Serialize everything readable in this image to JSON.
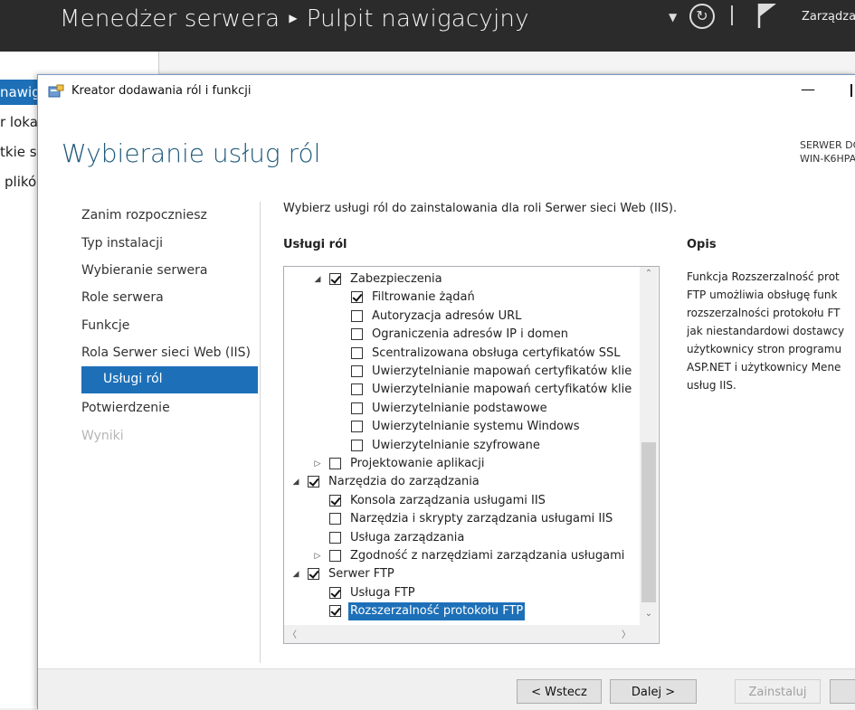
{
  "server_manager": {
    "title": "Menedżer serwera",
    "breadcrumb": "Pulpit nawigacyjny",
    "manage_menu": "Zarządza",
    "sidebar": [
      {
        "label": "nawig",
        "active": true
      },
      {
        "label": "r loka",
        "active": false
      },
      {
        "label": "tkie s",
        "active": false
      },
      {
        "label": "plikó",
        "active": false
      }
    ]
  },
  "wizard": {
    "window_title": "Kreator dodawania ról i funkcji",
    "page_title": "Wybieranie usług ról",
    "server_label_line1": "SERWER DO",
    "server_label_line2": "WIN-K6HPA",
    "steps": [
      {
        "label": "Zanim rozpoczniesz",
        "state": "normal"
      },
      {
        "label": "Typ instalacji",
        "state": "normal"
      },
      {
        "label": "Wybieranie serwera",
        "state": "normal"
      },
      {
        "label": "Role serwera",
        "state": "normal"
      },
      {
        "label": "Funkcje",
        "state": "normal"
      },
      {
        "label": "Rola Serwer sieci Web (IIS)",
        "state": "normal"
      },
      {
        "label": "Usługi ról",
        "state": "active"
      },
      {
        "label": "Potwierdzenie",
        "state": "normal"
      },
      {
        "label": "Wyniki",
        "state": "disabled"
      }
    ],
    "instruction": "Wybierz usługi ról do zainstalowania dla roli Serwer sieci Web (IIS).",
    "services_header": "Usługi ról",
    "description_header": "Opis",
    "description_lines": [
      "Funkcja Rozszerzalność prot",
      "FTP umożliwia obsługę funk",
      "rozszerzalności protokołu FT",
      "jak niestandardowi dostawcy",
      "użytkownicy stron programu",
      "ASP.NET i użytkownicy Mene",
      "usług IIS."
    ],
    "tree": [
      {
        "label": "Zabezpieczenia",
        "level": 1,
        "expander": "expanded",
        "checked": true
      },
      {
        "label": "Filtrowanie żądań",
        "level": 2,
        "expander": "none",
        "checked": true
      },
      {
        "label": "Autoryzacja adresów URL",
        "level": 2,
        "expander": "none",
        "checked": false
      },
      {
        "label": "Ograniczenia adresów IP i domen",
        "level": 2,
        "expander": "none",
        "checked": false
      },
      {
        "label": "Scentralizowana obsługa certyfikatów SSL",
        "level": 2,
        "expander": "none",
        "checked": false
      },
      {
        "label": "Uwierzytelnianie mapowań certyfikatów klie",
        "level": 2,
        "expander": "none",
        "checked": false
      },
      {
        "label": "Uwierzytelnianie mapowań certyfikatów klie",
        "level": 2,
        "expander": "none",
        "checked": false
      },
      {
        "label": "Uwierzytelnianie podstawowe",
        "level": 2,
        "expander": "none",
        "checked": false
      },
      {
        "label": "Uwierzytelnianie systemu Windows",
        "level": 2,
        "expander": "none",
        "checked": false
      },
      {
        "label": "Uwierzytelnianie szyfrowane",
        "level": 2,
        "expander": "none",
        "checked": false
      },
      {
        "label": "Projektowanie aplikacji",
        "level": 1,
        "expander": "collapsed",
        "checked": false
      },
      {
        "label": "Narzędzia do zarządzania",
        "level": 0,
        "expander": "expanded",
        "checked": true
      },
      {
        "label": "Konsola zarządzania usługami IIS",
        "level": 1,
        "expander": "none",
        "checked": true
      },
      {
        "label": "Narzędzia i skrypty zarządzania usługami IIS",
        "level": 1,
        "expander": "none",
        "checked": false
      },
      {
        "label": "Usługa zarządzania",
        "level": 1,
        "expander": "none",
        "checked": false
      },
      {
        "label": "Zgodność z narzędziami zarządzania usługami",
        "level": 1,
        "expander": "collapsed",
        "checked": false
      },
      {
        "label": "Serwer FTP",
        "level": 0,
        "expander": "expanded",
        "checked": true
      },
      {
        "label": "Usługa FTP",
        "level": 1,
        "expander": "none",
        "checked": true
      },
      {
        "label": "Rozszerzalność protokołu FTP",
        "level": 1,
        "expander": "none",
        "checked": true,
        "selected": true
      }
    ],
    "buttons": {
      "previous": "< Wstecz",
      "next": "Dalej >",
      "install": "Zainstaluj"
    }
  }
}
